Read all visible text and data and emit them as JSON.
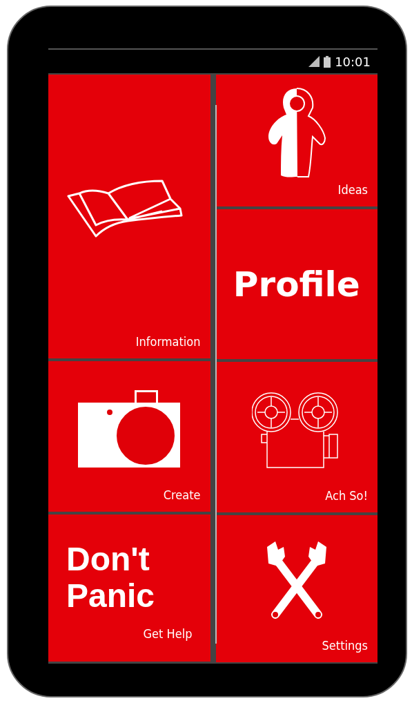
{
  "status_bar": {
    "time": "10:01"
  },
  "columns": [
    {
      "tiles": [
        {
          "kind": "icon",
          "label": "Information"
        },
        {
          "kind": "icon",
          "label": "Create"
        },
        {
          "kind": "headline",
          "headline": "Don't Panic",
          "label": "Get Help"
        }
      ]
    },
    {
      "tiles": [
        {
          "kind": "icon",
          "label": "Ideas"
        },
        {
          "kind": "headline",
          "headline": "Profile"
        },
        {
          "kind": "icon",
          "label": "Ach So!"
        },
        {
          "kind": "icon",
          "label": "Settings"
        }
      ]
    }
  ]
}
